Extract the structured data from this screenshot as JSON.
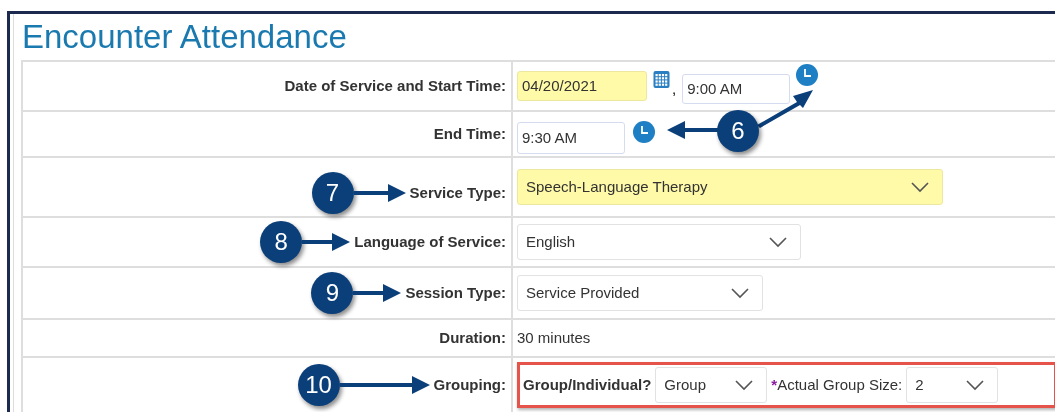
{
  "title": "Encounter Attendance",
  "rows": [
    {
      "kind": "datetime",
      "label": "Date of Service and Start Time:",
      "date": "04/20/2021",
      "date_highlighted": true,
      "separator": ",",
      "time": "9:00 AM"
    },
    {
      "kind": "time",
      "label": "End Time:",
      "time": "9:30 AM",
      "callout": "6"
    },
    {
      "kind": "select",
      "label": "Service Type:",
      "value": "Speech-Language Therapy",
      "highlighted": true,
      "callout": "7"
    },
    {
      "kind": "select",
      "label": "Language of Service:",
      "value": "English",
      "highlighted": false,
      "callout": "8"
    },
    {
      "kind": "select",
      "label": "Session Type:",
      "value": "Service Provided",
      "highlighted": false,
      "callout": "9"
    },
    {
      "kind": "text",
      "label": "Duration:",
      "value": "30 minutes"
    },
    {
      "kind": "grouping",
      "label": "Grouping:",
      "outlined": true,
      "callout": "10",
      "group_label": "Group/Individual?",
      "group_value": "Group",
      "size_required": true,
      "size_mark": "*",
      "size_label": "Actual Group Size:",
      "size_value": "2"
    }
  ]
}
